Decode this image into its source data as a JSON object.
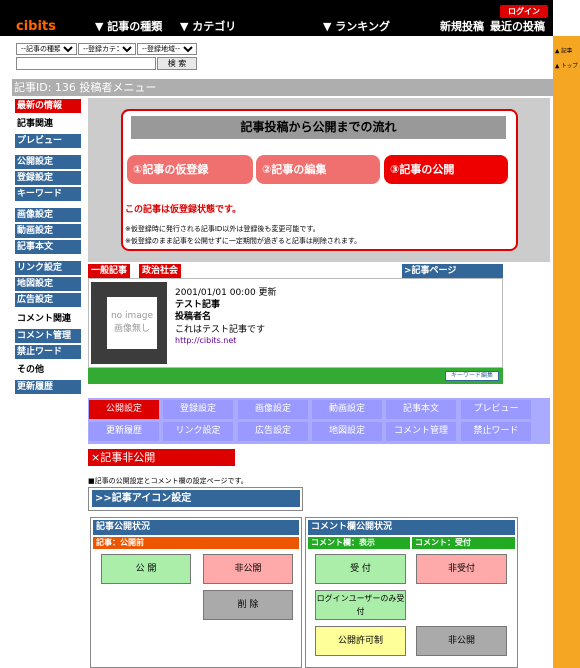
{
  "header": {
    "logo": "cibits",
    "nav": [
      "▼ 記事の種類",
      "▼ カテゴリ",
      "▼ ランキング",
      "新規投稿",
      "最近の投稿"
    ],
    "login": "ログイン"
  },
  "side_links": [
    "▲ 記事",
    "▲ トップ"
  ],
  "filters": {
    "type_select": "--記事の種類--",
    "category_select": "--登録カテゴリー--",
    "region_select": "--登録地域--",
    "search_button": "検 索"
  },
  "page_title": "記事ID: 136  投稿者メニュー",
  "left_menu": [
    {
      "label": "最新の情報",
      "style": "red"
    },
    {
      "label": "記事関連",
      "style": "head"
    },
    {
      "label": "プレビュー",
      "style": "blue"
    },
    {
      "label": "公開設定",
      "style": "blue"
    },
    {
      "label": "登録設定",
      "style": "blue"
    },
    {
      "label": "キーワード",
      "style": "blue"
    },
    {
      "label": "画像設定",
      "style": "blue"
    },
    {
      "label": "動画設定",
      "style": "blue"
    },
    {
      "label": "記事本文",
      "style": "blue"
    },
    {
      "label": "リンク設定",
      "style": "blue"
    },
    {
      "label": "地図設定",
      "style": "blue"
    },
    {
      "label": "広告設定",
      "style": "blue"
    },
    {
      "label": "コメント関連",
      "style": "head"
    },
    {
      "label": "コメント管理",
      "style": "blue"
    },
    {
      "label": "禁止ワード",
      "style": "blue"
    },
    {
      "label": "その他",
      "style": "head"
    },
    {
      "label": "更新履歴",
      "style": "blue"
    }
  ],
  "flow": {
    "title": "記事投稿から公開までの流れ",
    "steps": [
      "①記事の仮登録",
      "②記事の編集",
      "③記事の公開"
    ],
    "warning": "この記事は仮登録状態です。",
    "notes": [
      "※仮登録時に発行される記事ID以外は登録後も変更可能です。",
      "※仮登録のまま記事を公開せずに一定期間が過ぎると記事は削除されます。"
    ]
  },
  "article": {
    "tags": [
      "一般記事",
      "政治社会"
    ],
    "page_link": ">記事ページ",
    "no_image": [
      "no image",
      "画像無し"
    ],
    "date": "2001/01/01 00:00 更新",
    "title": "テスト記事",
    "author": "投稿者名",
    "body": "これはテスト記事です",
    "url": "http://cibits.net",
    "keyword_button": "キーワード編集"
  },
  "settings_tabs": [
    [
      "公開設定",
      "登録設定",
      "画像設定",
      "動画設定",
      "記事本文",
      "プレビュー"
    ],
    [
      "更新履歴",
      "リンク設定",
      "広告設定",
      "地図設定",
      "コメント管理",
      "禁止ワード"
    ]
  ],
  "status_banner": "×記事非公開",
  "description": "■記事の公開設定とコメント欄の設定ページです。",
  "icon_settings": ">>記事アイコン設定",
  "publish_panel": {
    "title": "記事公開状況",
    "sub": "記事：公開前",
    "buttons": [
      "公 開",
      "非公開",
      "削 除"
    ]
  },
  "comment_panel": {
    "title": "コメント欄公開状況",
    "sub_left": "コメント欄：表示",
    "sub_right": "コメント：受付",
    "buttons": [
      "受 付",
      "非受付",
      "ログインユーザーのみ受付",
      "公開許可制",
      "非公開"
    ]
  },
  "colors": {
    "brand_blue": "#336699",
    "alert_red": "#dd0000",
    "tab_purple": "#9999ff",
    "accent_orange": "#f5a623"
  }
}
